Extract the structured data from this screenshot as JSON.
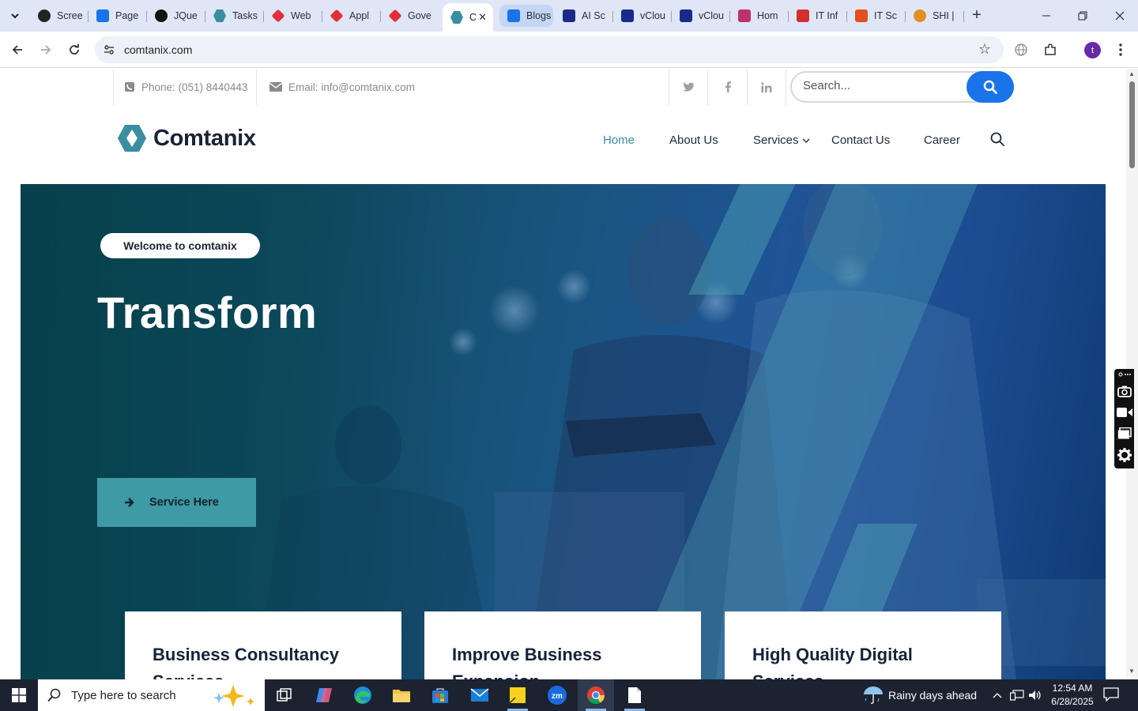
{
  "browser": {
    "tabs": [
      {
        "title": "Scree",
        "icon": "screen-icon",
        "color": "#222222"
      },
      {
        "title": "Page",
        "icon": "pagespeed-icon",
        "color": "#1a73e8"
      },
      {
        "title": "JQue",
        "icon": "jquery-icon",
        "color": "#111111"
      },
      {
        "title": "Tasks",
        "icon": "comtanix-icon",
        "color": "#3a8ea0"
      },
      {
        "title": "Web",
        "icon": "diamond-icon",
        "color": "#e0303a"
      },
      {
        "title": "Appl",
        "icon": "diamond-icon",
        "color": "#e0303a"
      },
      {
        "title": "Gove",
        "icon": "diamond-icon",
        "color": "#e0303a"
      },
      {
        "title": "C",
        "icon": "comtanix-icon",
        "color": "#3a8ea0"
      },
      {
        "title": "Blogs",
        "icon": "scales-icon",
        "color": "#1a73e8"
      },
      {
        "title": "AI Sc",
        "icon": "x-icon",
        "color": "#1a2a8a"
      },
      {
        "title": "vClou",
        "icon": "check-icon",
        "color": "#1a2a8a"
      },
      {
        "title": "vClou",
        "icon": "v-icon",
        "color": "#1a2a8a"
      },
      {
        "title": "Hom",
        "icon": "leaf-icon",
        "color": "#c0306a"
      },
      {
        "title": "IT Inf",
        "icon": "shield-icon",
        "color": "#d03030"
      },
      {
        "title": "IT Sc",
        "icon": "slash-icon",
        "color": "#e05020"
      },
      {
        "title": "SHI |",
        "icon": "ring-icon",
        "color": "#e09020"
      }
    ],
    "active_tab_index": 7,
    "url": "comtanix.com"
  },
  "site": {
    "phone": "Phone: (051) 8440443",
    "email": "Email: info@comtanix.com",
    "search_placeholder": "Search...",
    "logo_text": "Comtanix",
    "nav": {
      "home": "Home",
      "about": "About Us",
      "services": "Services",
      "contact": "Contact Us",
      "career": "Career"
    },
    "hero": {
      "welcome": "Welcome to comtanix",
      "title": "Transform",
      "cta": "Service Here"
    },
    "cards": [
      {
        "title": "Business Consultancy Services"
      },
      {
        "title": "Improve Business Expansion"
      },
      {
        "title": "High Quality Digital Services"
      }
    ]
  },
  "taskbar": {
    "search_placeholder": "Type here to search",
    "weather": "Rainy days ahead",
    "time": "12:54 AM",
    "date": "6/28/2025"
  },
  "colors": {
    "accent": "#3a8ea0",
    "hero_button": "#3e9aa4",
    "search_button": "#1a73e8"
  }
}
